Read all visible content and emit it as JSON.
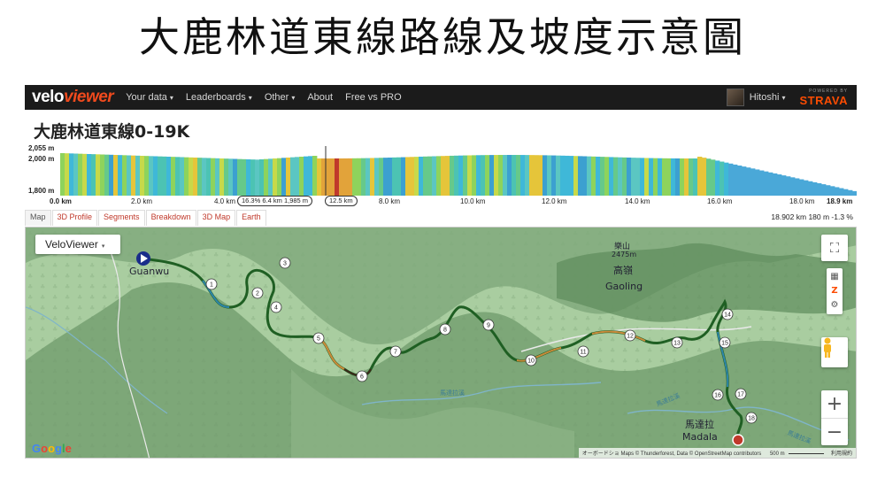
{
  "headline": "大鹿林道東線路線及坡度示意圖",
  "nav": {
    "logo_a": "velo",
    "logo_b": "viewer",
    "items": [
      "Your data",
      "Leaderboards",
      "Other",
      "About",
      "Free vs PRO"
    ],
    "user": "Hitoshi",
    "strava_small": "POWERED BY",
    "strava": "STRAVA"
  },
  "segment_title": "大鹿林道東線0-19K",
  "elevation": {
    "y_labels": [
      "2,055 m",
      "2,000 m",
      "1,800 m"
    ],
    "x_labels": [
      "0.0 km",
      "2.0 km",
      "4.0 km",
      "8.0 km",
      "10.0 km",
      "12.0 km",
      "14.0 km",
      "16.0 km",
      "18.0 km",
      "18.9 km"
    ],
    "marker_pill": "16.3% 6.4 km 1,985 m",
    "marker_pill2": "12.5 km"
  },
  "tabs": [
    "Map",
    "3D Profile",
    "Segments",
    "Breakdown",
    "3D Map",
    "Earth"
  ],
  "stats": "18.902 km 180 m -1.3 %",
  "map": {
    "style_select": "VeloViewer",
    "start_label": "Guanwu",
    "end_label_cn": "馬達拉",
    "end_label_en": "Madala",
    "peak_cn": "樂山",
    "peak_elev": "2475m",
    "place_cn": "高嶺",
    "place_en": "Gaoling",
    "river_a": "馬達拉溪",
    "river_b": "馬達拉溪",
    "river_c": "馬達拉溪",
    "km_markers": [
      "1",
      "2",
      "3",
      "4",
      "5",
      "6",
      "7",
      "8",
      "9",
      "10",
      "11",
      "12",
      "13",
      "14",
      "15",
      "16",
      "17",
      "18"
    ],
    "attribution": "オーボードショ Maps © Thunderforest, Data © OpenStreetMap contributors",
    "scale": "500 m",
    "terms": "利用規約",
    "google": "Google"
  },
  "colors": {
    "accent": "#f04a1d",
    "strava": "#fc4c02",
    "tab": "#c0392b",
    "route": "#1f5f23"
  }
}
